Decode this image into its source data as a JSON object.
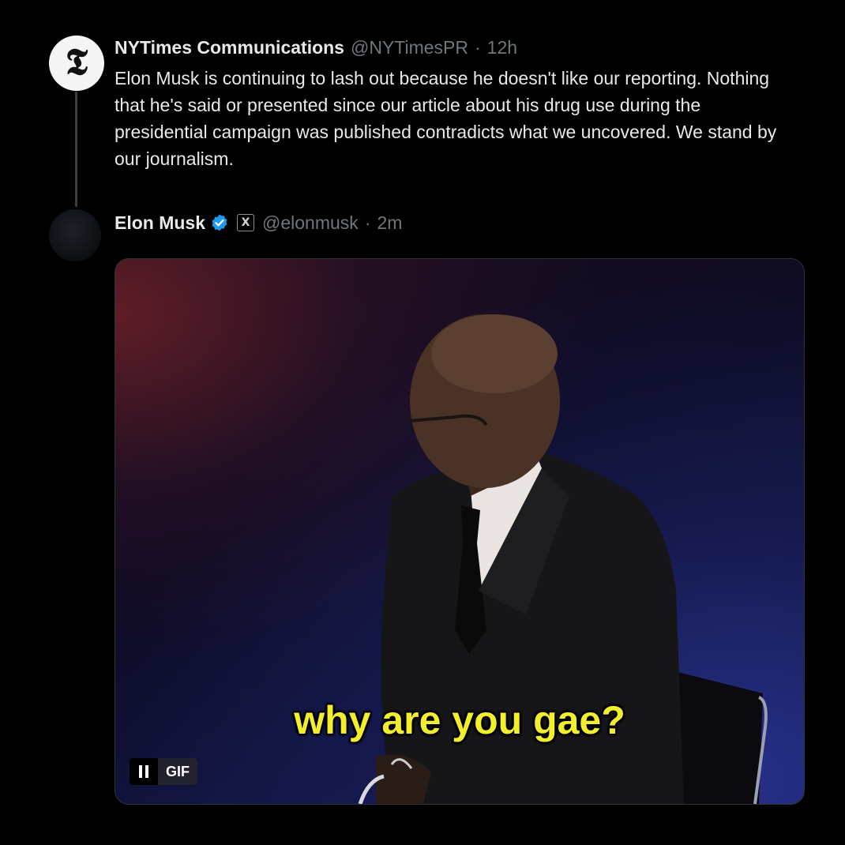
{
  "tweet1": {
    "display_name": "NYTimes Communications",
    "handle": "@NYTimesPR",
    "separator": "·",
    "time": "12h",
    "avatar_glyph": "𝕿",
    "text": "Elon Musk is continuing to lash out because he doesn't like our reporting. Nothing that he's said or presented since our article about his drug use during the presidential campaign was published contradicts what we uncovered. We stand by our journalism."
  },
  "tweet2": {
    "display_name": "Elon Musk",
    "badge_icon": "verified-badge-icon",
    "affiliation_glyph": "X",
    "handle": "@elonmusk",
    "separator": "·",
    "time": "2m",
    "media": {
      "caption": "why are you gae?",
      "gif_label": "GIF",
      "pause_icon": "pause-icon"
    }
  },
  "colors": {
    "background": "#000000",
    "text": "#e7e9ea",
    "muted": "#71767b",
    "verified": "#1d9bf0",
    "caption": "#f2ee2e"
  }
}
